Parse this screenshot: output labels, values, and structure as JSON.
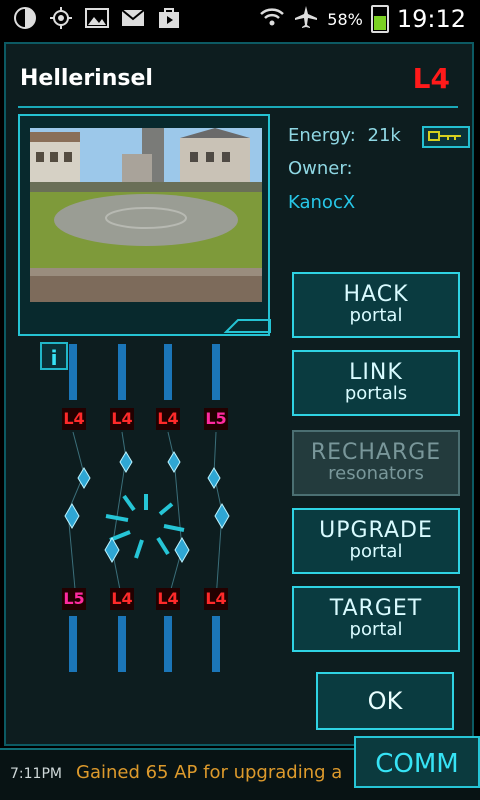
{
  "statusbar": {
    "battery": "58%",
    "battery_level": 0.58,
    "time": "19:12",
    "icons": [
      "data-sync-icon",
      "gps-icon",
      "gallery-icon",
      "gmail-icon",
      "play-store-icon",
      "wifi-icon",
      "airplane-mode-icon",
      "battery-icon"
    ]
  },
  "portal": {
    "name": "Hellerinsel",
    "level": "L4",
    "energy_label": "Energy:",
    "energy_value": "21k",
    "owner_label": "Owner:",
    "owner_name": "KanocX"
  },
  "actions": [
    {
      "title": "HACK",
      "sub": "portal",
      "enabled": true
    },
    {
      "title": "LINK",
      "sub": "portals",
      "enabled": true
    },
    {
      "title": "RECHARGE",
      "sub": "resonators",
      "enabled": false
    },
    {
      "title": "UPGRADE",
      "sub": "portal",
      "enabled": true
    },
    {
      "title": "TARGET",
      "sub": "portal",
      "enabled": true
    }
  ],
  "ok_label": "OK",
  "resonators": {
    "top": [
      "L4",
      "L4",
      "L4",
      "L5"
    ],
    "bottom": [
      "L5",
      "L4",
      "L4",
      "L4"
    ],
    "colors": {
      "L4": "#ff2a2a",
      "L5": "#ff2aa0"
    }
  },
  "comm": {
    "time": "7:11PM",
    "message": "Gained 65 AP for upgrading a",
    "button": "COMM"
  },
  "colors": {
    "accent": "#2fd3e3",
    "level_red": "#ff1a1a"
  }
}
